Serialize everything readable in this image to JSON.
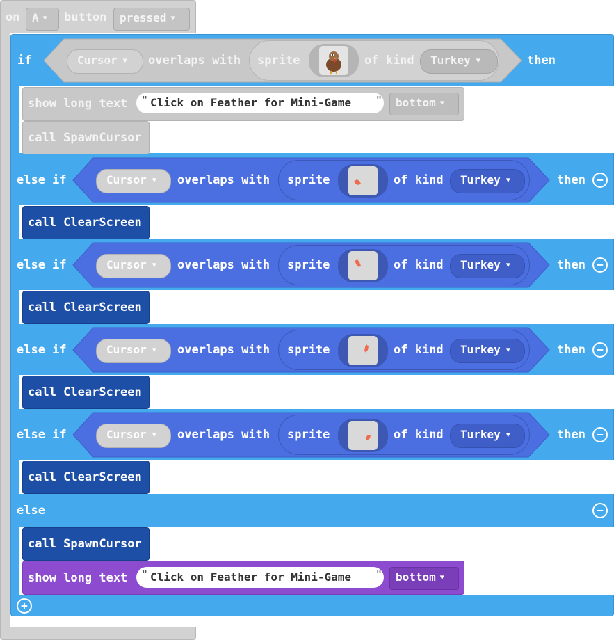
{
  "event": {
    "on": "on",
    "button": "A",
    "word_button": "button",
    "action": "pressed"
  },
  "if_block": {
    "if_word": "if",
    "then_word": "then",
    "cursor": "Cursor",
    "overlaps": "overlaps with",
    "sprite": "sprite",
    "of_kind": "of kind",
    "kind": "Turkey"
  },
  "disabled_show": {
    "label": "show long text",
    "text": "Click on Feather for Mini-Game",
    "position": "bottom"
  },
  "disabled_call": {
    "label": "call SpawnCursor"
  },
  "else_ifs": [
    {
      "label": "else if",
      "cursor": "Cursor",
      "overlaps": "overlaps with",
      "sprite": "sprite",
      "of_kind": "of kind",
      "kind": "Turkey",
      "then": "then",
      "call": "call ClearScreen"
    },
    {
      "label": "else if",
      "cursor": "Cursor",
      "overlaps": "overlaps with",
      "sprite": "sprite",
      "of_kind": "of kind",
      "kind": "Turkey",
      "then": "then",
      "call": "call ClearScreen"
    },
    {
      "label": "else if",
      "cursor": "Cursor",
      "overlaps": "overlaps with",
      "sprite": "sprite",
      "of_kind": "of kind",
      "kind": "Turkey",
      "then": "then",
      "call": "call ClearScreen"
    },
    {
      "label": "else if",
      "cursor": "Cursor",
      "overlaps": "overlaps with",
      "sprite": "sprite",
      "of_kind": "of kind",
      "kind": "Turkey",
      "then": "then",
      "call": "call ClearScreen"
    }
  ],
  "else_block": {
    "label": "else",
    "call": "call SpawnCursor"
  },
  "final_show": {
    "label": "show long text",
    "text": "Click on Feather for Mini-Game",
    "position": "bottom"
  },
  "icons": {
    "remove": "minus-circle-icon",
    "add": "plus-circle-icon",
    "dropdown": "chevron-down-icon",
    "turkey": "turkey-sprite-icon",
    "feather": "feather-sprite-icon"
  },
  "colors": {
    "event_disabled": "#d2d2d2",
    "logic": "#45a9ee",
    "sprites": "#4b6ee0",
    "sprite_dark": "#3f5ec8",
    "function": "#1e4fa7",
    "text": "#8d4ccf",
    "disabled": "#c8c8c8"
  }
}
